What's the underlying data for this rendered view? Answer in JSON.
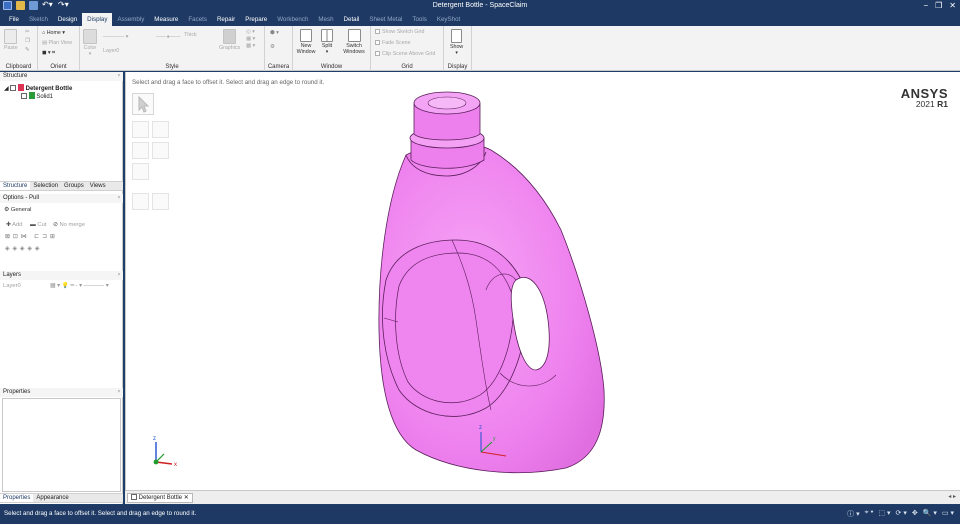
{
  "app": {
    "window_title": "Detergent Bottle - SpaceClaim",
    "window_controls": [
      "−",
      "❒",
      "✕"
    ],
    "quick_access_icons": [
      "spaceclaim-logo-icon",
      "open-icon",
      "save-icon",
      "undo-icon",
      "redo-icon"
    ]
  },
  "tabs": [
    {
      "label": "File",
      "state": "white"
    },
    {
      "label": "Sketch",
      "state": "dim"
    },
    {
      "label": "Design",
      "state": "white"
    },
    {
      "label": "Display",
      "state": "active"
    },
    {
      "label": "Assembly",
      "state": "dim"
    },
    {
      "label": "Measure",
      "state": "white"
    },
    {
      "label": "Facets",
      "state": "dim"
    },
    {
      "label": "Repair",
      "state": "white"
    },
    {
      "label": "Prepare",
      "state": "white"
    },
    {
      "label": "Workbench",
      "state": "dim"
    },
    {
      "label": "Mesh",
      "state": "dim"
    },
    {
      "label": "Detail",
      "state": "white"
    },
    {
      "label": "Sheet Metal",
      "state": "dim"
    },
    {
      "label": "Tools",
      "state": "dim"
    },
    {
      "label": "KeyShot",
      "state": "dim"
    }
  ],
  "ribbon": {
    "clipboard": {
      "label": "Clipboard",
      "paste": "Paste"
    },
    "orient": {
      "label": "Orient",
      "home": "Home",
      "plan_view": "Plan View"
    },
    "style": {
      "label": "Style",
      "color": "Color",
      "layer": "Layer0",
      "thick": "Thick",
      "graphics": "Graphics"
    },
    "camera": {
      "label": "Camera"
    },
    "window": {
      "label": "Window",
      "new_window": "New Window",
      "split": "Split",
      "switch_windows": "Switch Windows"
    },
    "grid": {
      "label": "Grid",
      "show_sketch_grid": "Show Sketch Grid",
      "fade_scene": "Fade Scene",
      "clip_scene": "Clip Scene Above Grid"
    },
    "display": {
      "label": "Display",
      "show": "Show"
    }
  },
  "structure": {
    "title": "Structure",
    "root": "Detergent Bottle",
    "child": "Solid1",
    "tabs": [
      "Structure",
      "Selection",
      "Groups",
      "Views"
    ]
  },
  "options": {
    "title": "Options - Pull",
    "general": "General",
    "add": "Add",
    "cut": "Cut",
    "no_merge": "No merge"
  },
  "layers": {
    "title": "Layers",
    "layer0": "Layer0"
  },
  "properties": {
    "title": "Properties",
    "tabs": [
      "Properties",
      "Appearance"
    ]
  },
  "viewport": {
    "hint": "Select and drag a face to offset it. Select and drag an edge to round it.",
    "brand": "ANSYS",
    "version_year": "2021",
    "version_release": "R1",
    "axis_x": "x",
    "axis_y": "y",
    "axis_z": "z",
    "bottle_color": "#ee80ee",
    "edge_color": "#5a1e5a"
  },
  "document_tab": {
    "label": "Detergent Bottle",
    "close": "✕"
  },
  "statusbar": {
    "text": "Select and drag a face to offset it. Select and drag an edge to round it."
  },
  "colors": {
    "chrome": "#1e3a64",
    "ribbon_bg": "#f3f3f3",
    "active_tab_text": "#1e3a64"
  }
}
